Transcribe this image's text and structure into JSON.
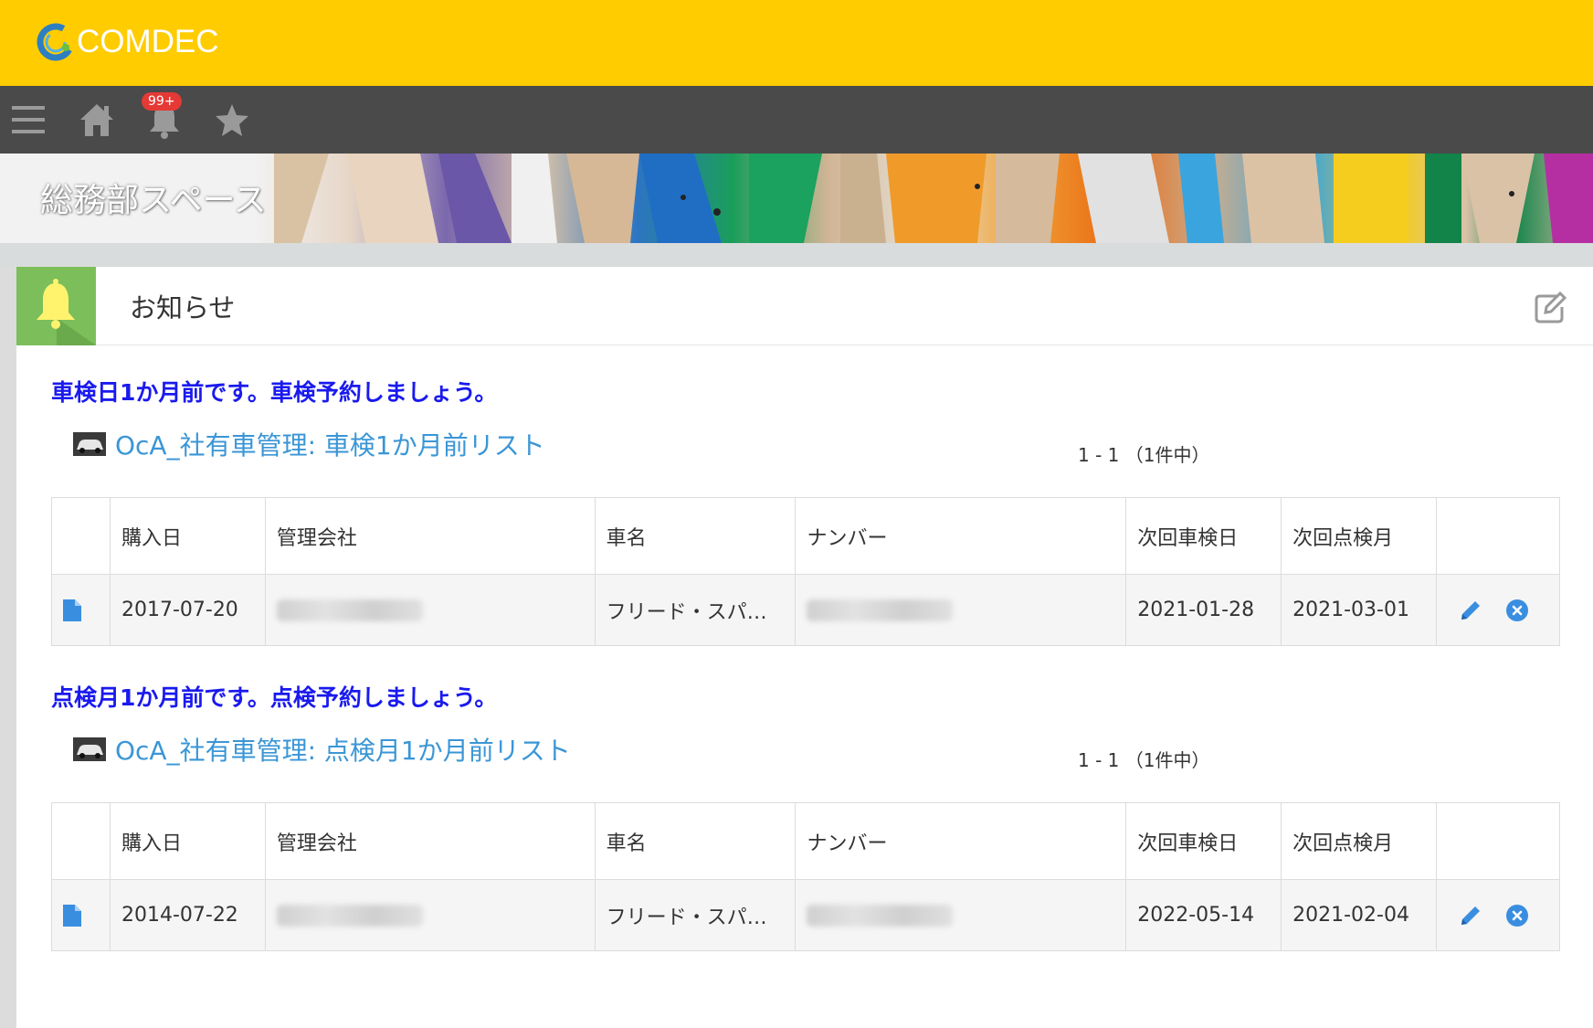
{
  "app": {
    "logo_text": "COMDEC"
  },
  "nav": {
    "badge": "99+"
  },
  "space": {
    "title": "総務部スペース"
  },
  "panel": {
    "title": "お知らせ"
  },
  "table_headers": [
    "購入日",
    "管理会社",
    "車名",
    "ナンバー",
    "次回車検日",
    "次回点検月"
  ],
  "sections": [
    {
      "notice": "車検日1か月前です。車検予約しましょう。",
      "list_title": "OcA_社有車管理: 車検1か月前リスト",
      "pager": "1 - 1 （1件中）",
      "rows": [
        {
          "purchase_date": "2017-07-20",
          "car_name": "フリード・スパ…",
          "next_inspection_date": "2021-01-28",
          "next_check_month": "2021-03-01"
        }
      ]
    },
    {
      "notice": "点検月1か月前です。点検予約しましょう。",
      "list_title": "OcA_社有車管理: 点検月1か月前リスト",
      "pager": "1 - 1 （1件中）",
      "rows": [
        {
          "purchase_date": "2014-07-22",
          "car_name": "フリード・スパ…",
          "next_inspection_date": "2022-05-14",
          "next_check_month": "2021-02-04"
        }
      ]
    }
  ],
  "colors": {
    "topbar": "#ffcc00",
    "navbar": "#4a4a4a",
    "notice": "#1a1aee",
    "link": "#3a96d6",
    "panel_icon": "#7cbf5a"
  }
}
